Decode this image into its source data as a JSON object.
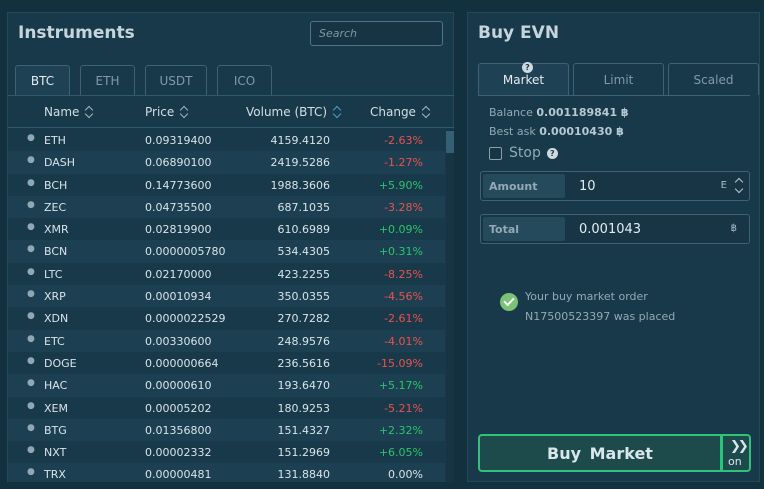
{
  "instruments": {
    "title": "Instruments",
    "search_placeholder": "Search",
    "tabs": [
      "BTC",
      "ETH",
      "USDT",
      "ICO"
    ],
    "columns": {
      "name": "Name",
      "price": "Price",
      "volume": "Volume (BTC)",
      "change": "Change"
    },
    "rows": [
      {
        "name": "ETH",
        "price": "0.09319400",
        "volume": "4159.4120",
        "change": "-2.63%"
      },
      {
        "name": "DASH",
        "price": "0.06890100",
        "volume": "2419.5286",
        "change": "-1.27%"
      },
      {
        "name": "BCH",
        "price": "0.14773600",
        "volume": "1988.3606",
        "change": "+5.90%"
      },
      {
        "name": "ZEC",
        "price": "0.04735500",
        "volume": "687.1035",
        "change": "-3.28%"
      },
      {
        "name": "XMR",
        "price": "0.02819900",
        "volume": "610.6989",
        "change": "+0.09%"
      },
      {
        "name": "BCN",
        "price": "0.0000005780",
        "volume": "534.4305",
        "change": "+0.31%"
      },
      {
        "name": "LTC",
        "price": "0.02170000",
        "volume": "423.2255",
        "change": "-8.25%"
      },
      {
        "name": "XRP",
        "price": "0.00010934",
        "volume": "350.0355",
        "change": "-4.56%"
      },
      {
        "name": "XDN",
        "price": "0.0000022529",
        "volume": "270.7282",
        "change": "-2.61%"
      },
      {
        "name": "ETC",
        "price": "0.00330600",
        "volume": "248.9576",
        "change": "-4.01%"
      },
      {
        "name": "DOGE",
        "price": "0.000000664",
        "volume": "236.5616",
        "change": "-15.09%"
      },
      {
        "name": "HAC",
        "price": "0.00000610",
        "volume": "193.6470",
        "change": "+5.17%"
      },
      {
        "name": "XEM",
        "price": "0.00005202",
        "volume": "180.9253",
        "change": "-5.21%"
      },
      {
        "name": "BTG",
        "price": "0.01356800",
        "volume": "151.4327",
        "change": "+2.32%"
      },
      {
        "name": "NXT",
        "price": "0.00002332",
        "volume": "151.2969",
        "change": "+6.05%"
      },
      {
        "name": "TRX",
        "price": "0.00000481",
        "volume": "131.8840",
        "change": "0.00%"
      }
    ]
  },
  "buy": {
    "title": "Buy EVN",
    "tabs": [
      "Market",
      "Limit",
      "Scaled"
    ],
    "balance_label": "Balance",
    "balance_value": "0.001189841 ฿",
    "best_ask_label": "Best ask",
    "best_ask_value": "0.00010430 ฿",
    "stop_label": "Stop",
    "amount_label": "Amount",
    "amount_value": "10",
    "amount_unit": "E",
    "total_label": "Total",
    "total_value": "0.001043",
    "total_unit": "฿",
    "notice_line1": "Your buy market order",
    "notice_line2": "N17500523397 was placed",
    "buy_button": "Buy Market",
    "on_label": "on"
  },
  "colors": {
    "negative": "#e9524f",
    "positive": "#2cc46b",
    "accent_green": "#2ec27a"
  }
}
